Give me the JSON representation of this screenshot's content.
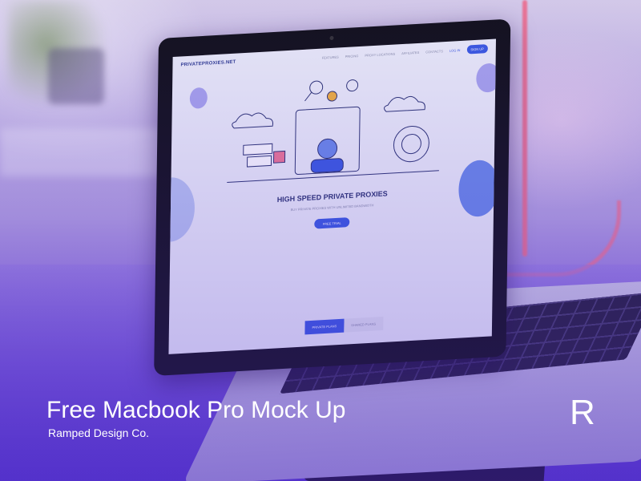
{
  "caption": {
    "title": "Free Macbook Pro Mock Up",
    "subtitle": "Ramped Design Co.",
    "brand_mark": "R"
  },
  "website": {
    "logo": "PRIVATEPROXIES.NET",
    "nav": [
      "FEATURES",
      "PRICING",
      "PROXY LOCATIONS",
      "AFFILIATES",
      "CONTACTS"
    ],
    "sign_in": "LOG IN",
    "sign_up": "SIGN UP",
    "hero_title": "HIGH SPEED PRIVATE PROXIES",
    "hero_subtitle": "BUY PRIVATE PROXIES WITH UNLIMITED BANDWIDTH",
    "cta": "FREE TRIAL",
    "tabs": [
      "PRIVATE PLANS",
      "SHARED PLANS"
    ]
  },
  "colors": {
    "accent": "#3a5be0",
    "overlay_purple": "#5633c4",
    "lamp_pink": "#f07893"
  }
}
